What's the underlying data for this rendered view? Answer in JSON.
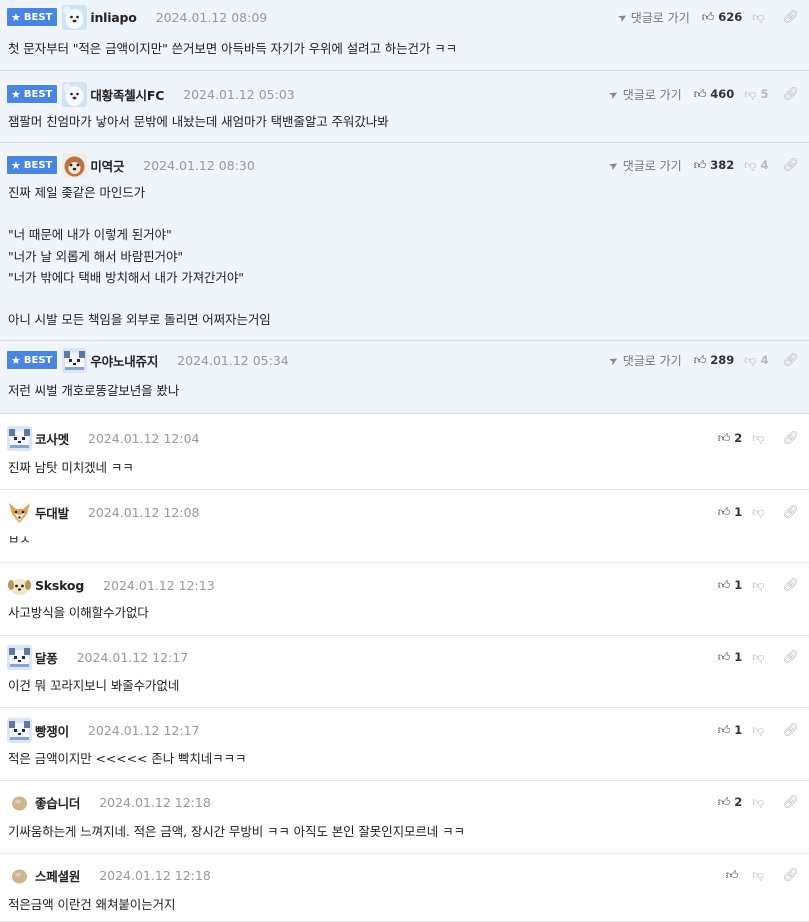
{
  "ui": {
    "best_label": "BEST",
    "reply_label": "댓글로 가기"
  },
  "comments": [
    {
      "best": true,
      "avatar": "avatar-white-dog",
      "nickname": "inliapo",
      "date": "2024.01.12 08:09",
      "likes": "626",
      "dislikes": "",
      "show_reply": true,
      "body": "첫 문자부터 \"적은 금액이지만\" 쓴거보면 아득바득 자기가 우위에 설려고 하는건가 ㅋㅋ"
    },
    {
      "best": true,
      "avatar": "avatar-white-dog",
      "nickname": "대황족첼시FC",
      "date": "2024.01.12 05:03",
      "likes": "460",
      "dislikes": "5",
      "show_reply": true,
      "body": "잼팔머 친엄마가 낳아서 문밖에 내놨는데 새엄마가 택밴줄알고 주워갔나봐"
    },
    {
      "best": true,
      "avatar": "avatar-brown-dog",
      "nickname": "미역긋",
      "date": "2024.01.12 08:30",
      "likes": "382",
      "dislikes": "4",
      "show_reply": true,
      "body": "진짜 제일 좆같은 마인드가\n\n\"너 때문에 내가 이렇게 된거야\"\n\"너가 날 외롭게 해서 바람핀거야\"\n\"너가 밖에다 택배 방치해서 내가 가져간거야\"\n\n아니 시발 모든 책임을 외부로 돌리면 어쩌자는거임"
    },
    {
      "best": true,
      "avatar": "avatar-pixel-dog",
      "nickname": "우야노내쥬지",
      "date": "2024.01.12 05:34",
      "likes": "289",
      "dislikes": "4",
      "show_reply": true,
      "body": "저런 씨벌 개호로똥갈보년을 봤나"
    },
    {
      "best": false,
      "avatar": "avatar-pixel-dog",
      "nickname": "코사멧",
      "date": "2024.01.12 12:04",
      "likes": "2",
      "dislikes": "",
      "show_reply": false,
      "body": "진짜 남탓 미치겠네 ㅋㅋ"
    },
    {
      "best": false,
      "avatar": "avatar-fox",
      "nickname": "두대발",
      "date": "2024.01.12 12:08",
      "likes": "1",
      "dislikes": "",
      "show_reply": false,
      "body": "ㅂㅅ"
    },
    {
      "best": false,
      "avatar": "avatar-puppy",
      "nickname": "Skskog",
      "date": "2024.01.12 12:13",
      "likes": "1",
      "dislikes": "",
      "show_reply": false,
      "body": "사고방식을 이해할수가없다"
    },
    {
      "best": false,
      "avatar": "avatar-pixel-dog",
      "nickname": "달퐁",
      "date": "2024.01.12 12:17",
      "likes": "1",
      "dislikes": "",
      "show_reply": false,
      "body": "이건 뭐 꼬라지보니 봐줄수가없네"
    },
    {
      "best": false,
      "avatar": "avatar-pixel-dog",
      "nickname": "빵쟁이",
      "date": "2024.01.12 12:17",
      "likes": "1",
      "dislikes": "",
      "show_reply": false,
      "body": "적은 금액이지만 <<<<< 존나 빡치네ㅋㅋㅋ"
    },
    {
      "best": false,
      "avatar": "avatar-egg",
      "nickname": "좋습니더",
      "date": "2024.01.12 12:18",
      "likes": "2",
      "dislikes": "",
      "show_reply": false,
      "body": "기싸움하는게 느껴지네. 적은 금액, 장시간 무방비 ㅋㅋ 아직도 본인 잘못인지모르네 ㅋㅋ"
    },
    {
      "best": false,
      "avatar": "avatar-egg",
      "nickname": "스페셜원",
      "date": "2024.01.12 12:18",
      "likes": "",
      "dislikes": "",
      "show_reply": false,
      "body": "적은금액 이란건 왜쳐붙이는거지"
    }
  ]
}
